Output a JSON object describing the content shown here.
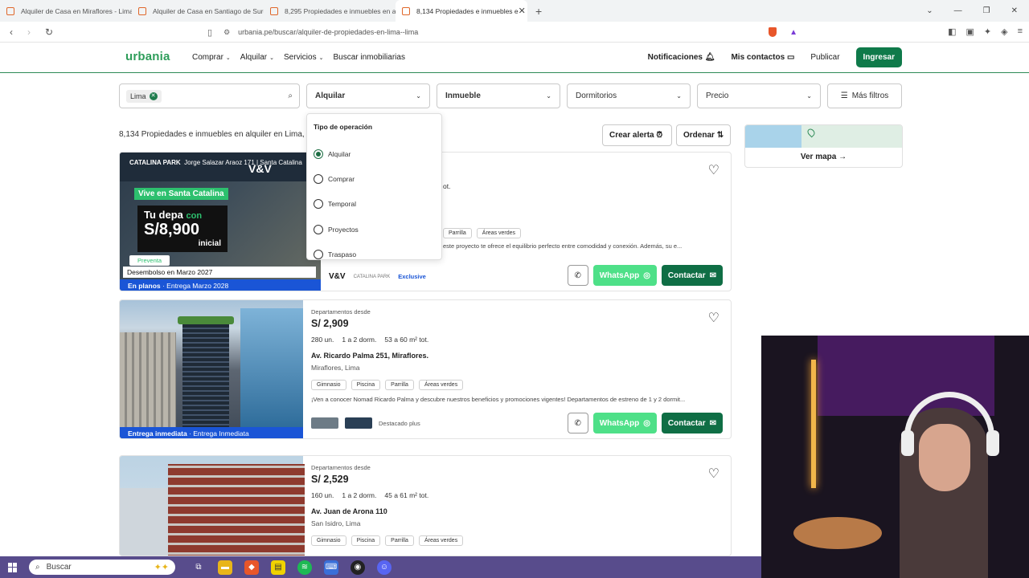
{
  "browser": {
    "tabs": [
      {
        "title": "Alquiler de Casa en Miraflores - Lima"
      },
      {
        "title": "Alquiler de Casa en Santiago de Surco"
      },
      {
        "title": "8,295 Propiedades e inmuebles en al"
      },
      {
        "title": "8,134 Propiedades e inmuebles e"
      }
    ],
    "url": "urbania.pe/buscar/alquiler-de-propiedades-en-lima--lima"
  },
  "header": {
    "logo": "urbania",
    "nav": [
      "Comprar",
      "Alquilar",
      "Servicios",
      "Buscar inmobiliarias"
    ],
    "notifications": "Notificaciones",
    "contacts": "Mis contactos",
    "publish": "Publicar",
    "login": "Ingresar"
  },
  "filters": {
    "location_chip": "Lima",
    "operation": "Alquilar",
    "property": "Inmueble",
    "bedrooms": "Dormitorios",
    "price": "Precio",
    "more": "Más filtros"
  },
  "dropdown": {
    "title": "Tipo de operación",
    "options": [
      "Alquilar",
      "Comprar",
      "Temporal",
      "Proyectos",
      "Traspaso"
    ],
    "selected": "Alquilar"
  },
  "results": {
    "count_text": "8,134 Propiedades e inmuebles en alquiler en Lima,",
    "create_alert": "Crear alerta",
    "order": "Ordenar",
    "map_button": "Ver mapa"
  },
  "listings": [
    {
      "image": {
        "top_left": "CATALINA PARK",
        "top_text": "Jorge Salazar Araoz 171 | Santa Catalina",
        "brand": "V&V",
        "vive": "Vive en Santa Catalina",
        "tu_depa": "Tu depa",
        "con": "con",
        "amount": "S/8,900",
        "inicial": "inicial",
        "preventa": "Preventa",
        "desembolso": "Desembolso en Marzo 2027",
        "bar_bold": "En planos",
        "bar_rest": " · Entrega Marzo 2028"
      },
      "partial_price_suffix": "ot.",
      "tags_visible": [
        "Parrilla",
        "Áreas verdes"
      ],
      "desc": "este proyecto te ofrece el equilibrio perfecto entre comodidad y conexión. Además, su e...",
      "publisher_label": "Exclusive",
      "whatsapp": "WhatsApp",
      "contact": "Contactar"
    },
    {
      "pretitle": "Departamentos desde",
      "price": "S/ 2,909",
      "units": "280 un.",
      "rooms": "1 a 2 dorm.",
      "area": "53 a 60 m² tot.",
      "address": "Av. Ricardo Palma 251, Miraflores.",
      "location": "Miraflores, Lima",
      "tags": [
        "Gimnasio",
        "Piscina",
        "Parrilla",
        "Áreas verdes"
      ],
      "desc": "¡Ven a conocer Nomad Ricardo Palma y descubre nuestros beneficios y promociones vigentes! Departamentos de estreno de 1 y 2 dormit...",
      "publisher_label": "Destacado plus",
      "bar_bold": "Entrega inmediata",
      "bar_rest": " · Entrega Inmediata",
      "whatsapp": "WhatsApp",
      "contact": "Contactar"
    },
    {
      "pretitle": "Departamentos desde",
      "price": "S/ 2,529",
      "units": "160 un.",
      "rooms": "1 a 2 dorm.",
      "area": "45 a 61 m² tot.",
      "address": "Av. Juan de Arona 110",
      "location": "San Isidro, Lima",
      "tags": [
        "Gimnasio",
        "Piscina",
        "Parrilla",
        "Áreas verdes"
      ]
    }
  ],
  "taskbar": {
    "search": "Buscar"
  }
}
